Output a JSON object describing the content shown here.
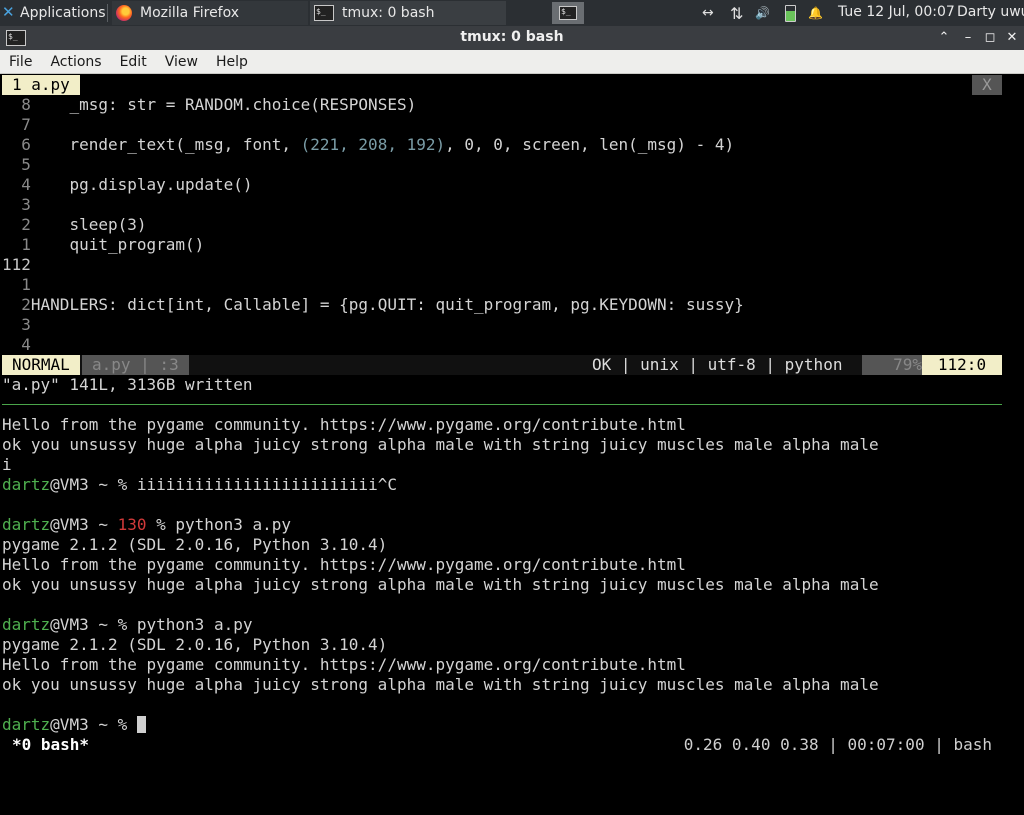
{
  "panel": {
    "applications_label": "Applications",
    "tasks": [
      {
        "label": "Mozilla Firefox"
      },
      {
        "label": "tmux: 0 bash"
      }
    ],
    "tray_network": "↔",
    "tray_updown": "⇅",
    "tray_volume": "🔊",
    "tray_bell": "🔔",
    "clock": "Tue 12 Jul, 00:07",
    "user": "Darty uwu"
  },
  "window": {
    "title": "tmux: 0 bash",
    "min_glyph": "⌃",
    "max_glyph": "–",
    "restore_glyph": "◻",
    "close_glyph": "✕"
  },
  "menu": {
    "items": [
      "File",
      "Actions",
      "Edit",
      "View",
      "Help"
    ]
  },
  "vim": {
    "tab_label": "1 a.py",
    "tab_close": "X",
    "lines": [
      {
        "ln": "  8",
        "code": "    _msg: str = RANDOM.choice(RESPONSES)"
      },
      {
        "ln": "  7",
        "code": ""
      },
      {
        "ln": "  6",
        "code_pre": "    render_text(_msg, font, ",
        "code_num": "(221, 208, 192)",
        "code_post": ", 0, 0, screen, len(_msg) - 4)"
      },
      {
        "ln": "  5",
        "code": ""
      },
      {
        "ln": "  4",
        "code": "    pg.display.update()"
      },
      {
        "ln": "  3",
        "code": ""
      },
      {
        "ln": "  2",
        "code": "    sleep(3)"
      },
      {
        "ln": "  1",
        "code": "    quit_program()"
      },
      {
        "ln": "112",
        "code": ""
      },
      {
        "ln": "  1",
        "code": ""
      },
      {
        "ln": "  2",
        "code": "HANDLERS: dict[int, Callable] = {pg.QUIT: quit_program, pg.KEYDOWN: sussy}"
      },
      {
        "ln": "  3",
        "code": ""
      },
      {
        "ln": "  4",
        "code": ""
      }
    ],
    "status": {
      "mode": "NORMAL",
      "file": "a.py | :3",
      "info": "OK | unix | utf-8 | python",
      "percent": "79%",
      "position": "112:0"
    },
    "message": "\"a.py\" 141L, 3136B written"
  },
  "shell": {
    "lines": [
      {
        "text": "Hello from the pygame community. https://www.pygame.org/contribute.html"
      },
      {
        "text": "ok you unsussy huge alpha juicy strong alpha male with string juicy muscles male alpha male"
      },
      {
        "text": "i"
      },
      {
        "user": "dartz",
        "host": "@VM3 ~ ",
        "code": "",
        "prompt": "% ",
        "cmd": "iiiiiiiiiiiiiiiiiiiiiiiii^C"
      },
      {
        "text": ""
      },
      {
        "user": "dartz",
        "host": "@VM3 ~ ",
        "code": "130 ",
        "prompt": "% ",
        "cmd": "python3 a.py"
      },
      {
        "text": "pygame 2.1.2 (SDL 2.0.16, Python 3.10.4)"
      },
      {
        "text": "Hello from the pygame community. https://www.pygame.org/contribute.html"
      },
      {
        "text": "ok you unsussy huge alpha juicy strong alpha male with string juicy muscles male alpha male"
      },
      {
        "text": ""
      },
      {
        "user": "dartz",
        "host": "@VM3 ~ ",
        "code": "",
        "prompt": "% ",
        "cmd": "python3 a.py"
      },
      {
        "text": "pygame 2.1.2 (SDL 2.0.16, Python 3.10.4)"
      },
      {
        "text": "Hello from the pygame community. https://www.pygame.org/contribute.html"
      },
      {
        "text": "ok you unsussy huge alpha juicy strong alpha male with string juicy muscles male alpha male"
      },
      {
        "text": ""
      },
      {
        "user": "dartz",
        "host": "@VM3 ~ ",
        "code": "",
        "prompt": "% ",
        "cmd": ""
      }
    ]
  },
  "tmux": {
    "window": "*0 bash*",
    "right": "0.26 0.40 0.38 | 00:07:00 | bash"
  }
}
